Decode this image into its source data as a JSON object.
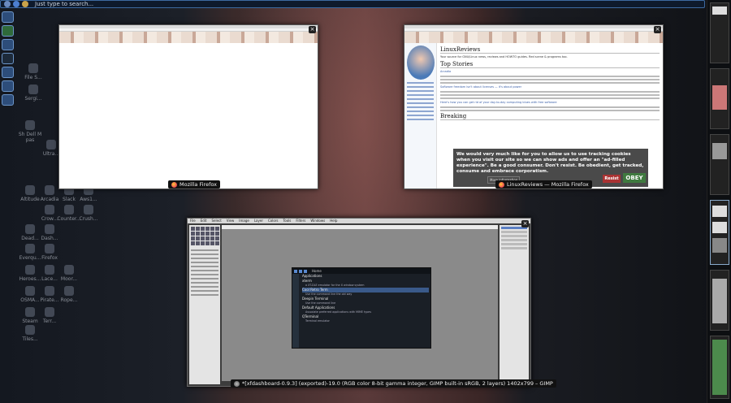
{
  "search": {
    "placeholder": "Just type to search..."
  },
  "desktop_icons": [
    "File S...",
    "Sergi...",
    "Sh Dell M pas",
    "Ultra...",
    "Altitude",
    "Arcadia",
    "Slack",
    "Aws1...",
    "Crow...",
    "Counter...",
    "Crush...",
    "Dead...",
    "Dash...",
    "Everqu...",
    "Firefox",
    "Heroes...",
    "Lace...",
    "Moor...",
    "OSMA...",
    "Pirate...",
    "Rope...",
    "Steam",
    "Terr...",
    "Tiles..."
  ],
  "windows": {
    "firefox_left": {
      "caption": "Mozilla Firefox",
      "close": "×"
    },
    "firefox_right": {
      "caption": "LinuxReviews — Mozilla Firefox",
      "close": "×",
      "page_title": "LinuxReviews",
      "intro": "Your source for GNU/Linux news, reviews and HOWTO guides. Red scene & programs too.",
      "section_top": "Top Stories",
      "story1_title": "Arcadia",
      "story2_title": "Software freedom isn't about licenses — it's about power",
      "story3_title": "Here's how you can get rid of your day-to-day computing blues with free software",
      "section_break": "Breaking",
      "cookie_text": "We would very much like for you to allow us to use tracking cookies when you visit our site so we can show ads and offer an \"ad-filled experience\". Be a good consumer. Don't resist. Be obedient, get tracked, consume and embrace corporatism.",
      "cookie_more": "More information",
      "resist_label": "Resist",
      "obey_label": "OBEY"
    },
    "gimp": {
      "caption": "*[xfdashboard-0.9.3] (exported)-19.0 (RGB color 8-bit gamma integer, GIMP built-in sRGB, 2 layers) 1402x799 – GIMP",
      "menu": [
        "File",
        "Edit",
        "Select",
        "View",
        "Image",
        "Layer",
        "Colors",
        "Tools",
        "Filters",
        "Windows",
        "Help"
      ],
      "xfd_header": "Home",
      "xfd_items": [
        {
          "label": "Applications",
          "sub": ""
        },
        {
          "label": "xterm",
          "sub": "a XT-DLE emulator for the X window system"
        },
        {
          "label": "Cool Retro Term",
          "sub": "Use the command line the old way"
        },
        {
          "label": "Deepin Terminal",
          "sub": "Use the command line"
        },
        {
          "label": "Default Applications",
          "sub": "Associate preferred applications with MIME types"
        },
        {
          "label": "QTerminal",
          "sub": "Terminal emulator"
        }
      ]
    }
  },
  "colors": {
    "accent": "#3d6aa0",
    "obey_green": "#3f7a3f",
    "resist_red": "#aa3333"
  }
}
